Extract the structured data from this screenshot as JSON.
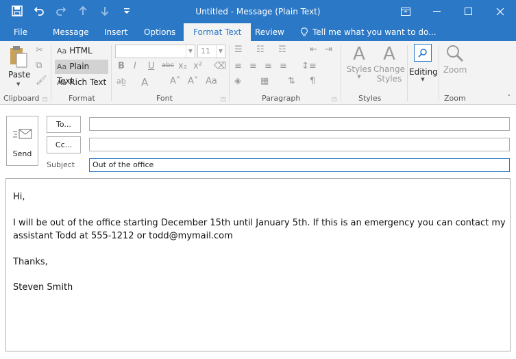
{
  "window": {
    "title": "Untitled - Message (Plain Text)"
  },
  "tabs": [
    {
      "label": "File"
    },
    {
      "label": "Message"
    },
    {
      "label": "Insert"
    },
    {
      "label": "Options"
    },
    {
      "label": "Format Text",
      "active": true
    },
    {
      "label": "Review"
    },
    {
      "label": "Tell me what you want to do..."
    }
  ],
  "ribbon": {
    "clipboard": {
      "label": "Clipboard",
      "paste_label": "Paste"
    },
    "format": {
      "label": "Format",
      "items": [
        "HTML",
        "Plain Text",
        "Rich Text"
      ],
      "selected": "Plain Text",
      "icon_text": "Aa"
    },
    "font": {
      "label": "Font",
      "font_name": "",
      "font_size": "11"
    },
    "paragraph": {
      "label": "Paragraph"
    },
    "styles": {
      "label": "Styles",
      "styles_label": "Styles",
      "change_styles_label": "Change Styles"
    },
    "editing": {
      "label": "Editing"
    },
    "zoom": {
      "label": "Zoom",
      "zoom_label": "Zoom"
    }
  },
  "compose": {
    "send_label": "Send",
    "to_label": "To...",
    "cc_label": "Cc...",
    "subject_label": "Subject",
    "to_value": "",
    "cc_value": "",
    "subject_value": "Out of the office"
  },
  "body": {
    "lines": [
      "Hi,",
      "I will be out of the office starting December 15th until January 5th. If this is an emergency you can contact my",
      "assistant Todd at 555-1212 or todd@mymail.com",
      "Thanks,",
      "Steven Smith"
    ]
  },
  "colors": {
    "accent": "#2b78c6",
    "ribbon_bg": "#f3f3f3"
  }
}
